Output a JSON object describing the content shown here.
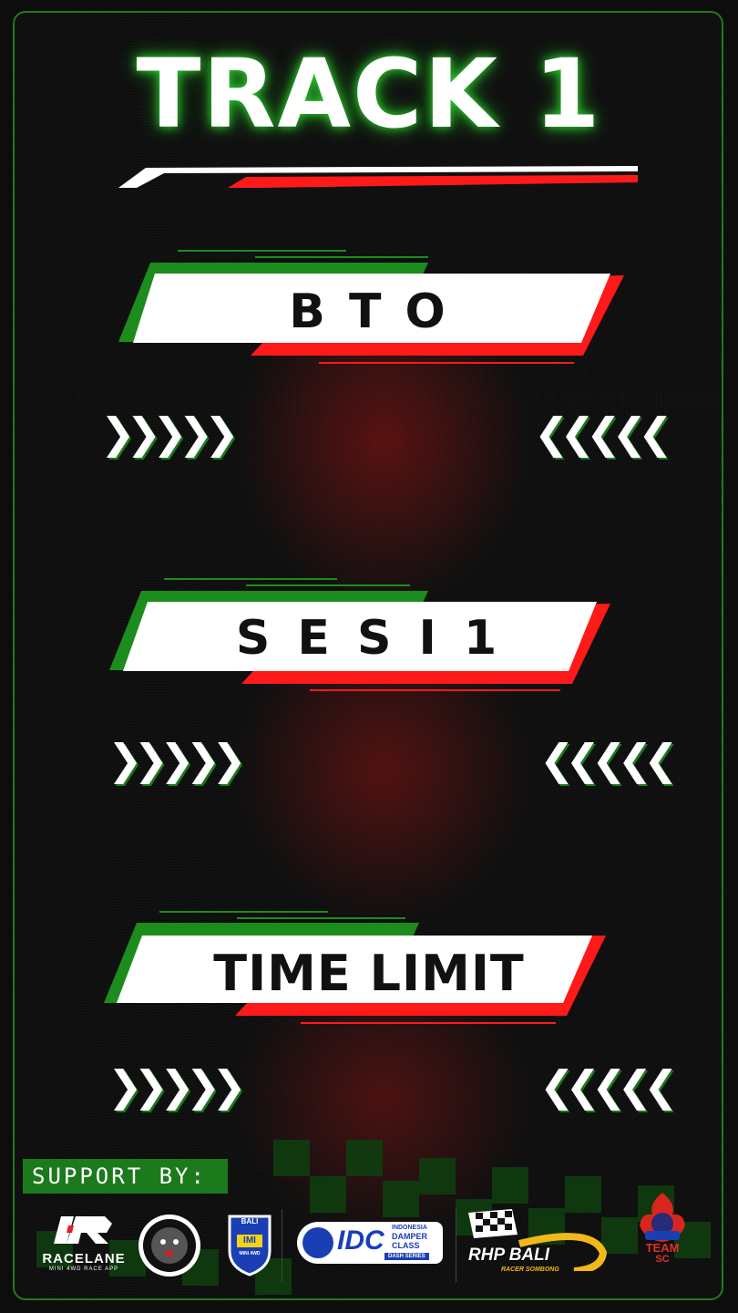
{
  "title": "TRACK 1",
  "banners": [
    {
      "label": "B T O"
    },
    {
      "label": "S E S I  1"
    },
    {
      "label": "TIME LIMIT"
    }
  ],
  "arrows": {
    "right": "❯❯❯❯❯",
    "left": "❮❮❮❮❮"
  },
  "support_label": "SUPPORT BY:",
  "logos": {
    "racelane": {
      "name": "RACELANE",
      "tagline": "MINI 4WD RACE APP"
    },
    "bali_imi": {
      "top": "BALI",
      "mid": "IMI",
      "bottom": "MINI 4WD"
    },
    "idc": {
      "mark": "IDC",
      "line1": "INDONESIA",
      "line2": "DAMPER",
      "line3": "CLASS",
      "line4": "DASH SERIES"
    },
    "rhp": {
      "name": "RHP BALI",
      "tagline": "RACER SOMBONG"
    },
    "team": {
      "line1": "TEAM",
      "line2": "SC"
    }
  },
  "colors": {
    "green": "#1c8c1c",
    "red": "#ff1a1a",
    "white": "#ffffff",
    "accent_glow": "#2fcc2f"
  }
}
